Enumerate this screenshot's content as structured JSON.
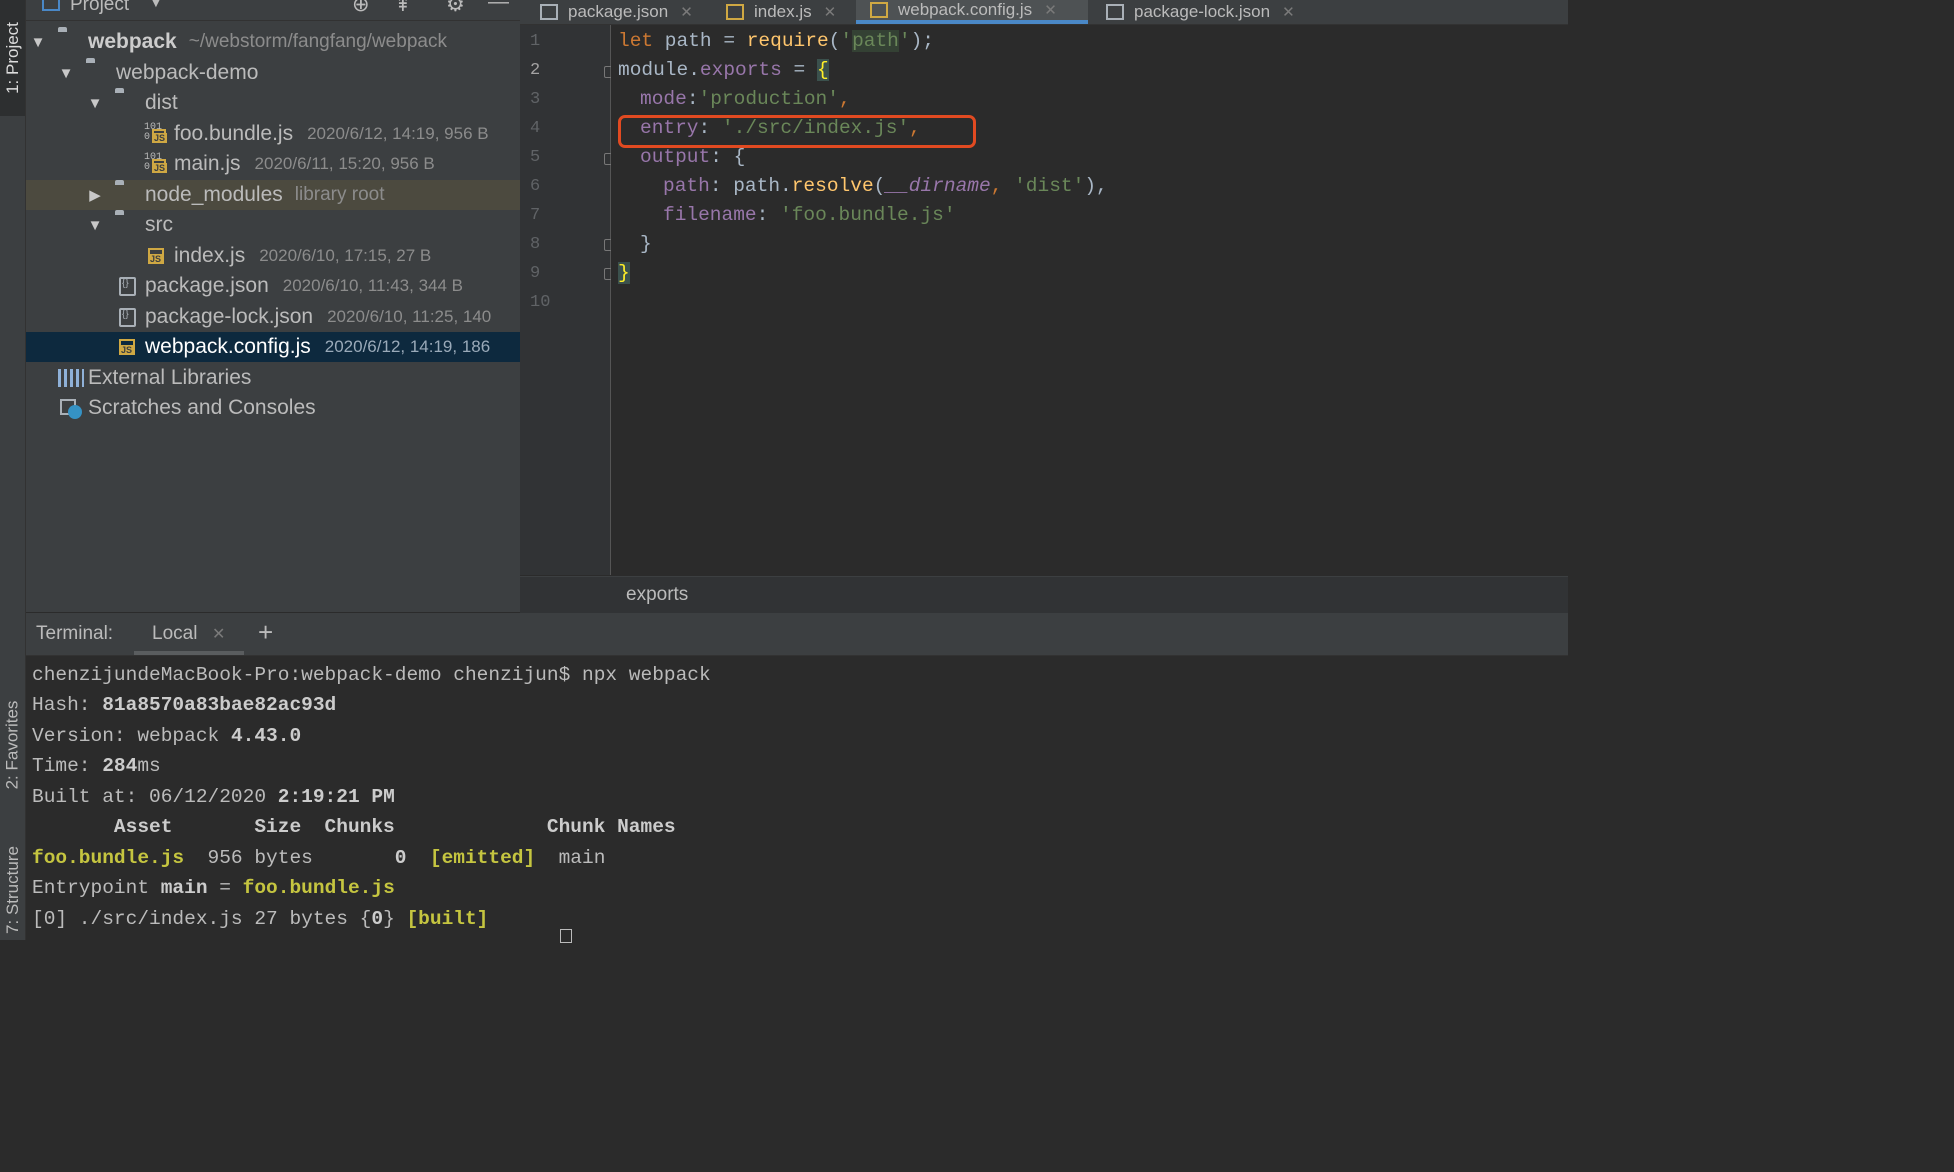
{
  "tool_windows": {
    "project": "1: Project",
    "favorites": "2: Favorites",
    "structure": "7: Structure"
  },
  "project_panel": {
    "title": "Project",
    "tree": [
      {
        "name": "webpack",
        "meta": "~/webstorm/fangfang/webpack"
      },
      {
        "name": "webpack-demo",
        "meta": ""
      },
      {
        "name": "dist",
        "meta": ""
      },
      {
        "name": "foo.bundle.js",
        "meta": "2020/6/12, 14:19, 956 B"
      },
      {
        "name": "main.js",
        "meta": "2020/6/11, 15:20, 956 B"
      },
      {
        "name": "node_modules",
        "meta": "library root"
      },
      {
        "name": "src",
        "meta": ""
      },
      {
        "name": "index.js",
        "meta": "2020/6/10, 17:15, 27 B"
      },
      {
        "name": "package.json",
        "meta": "2020/6/10, 11:43, 344 B"
      },
      {
        "name": "package-lock.json",
        "meta": "2020/6/10, 11:25, 140"
      },
      {
        "name": "webpack.config.js",
        "meta": "2020/6/12, 14:19, 186"
      },
      {
        "name": "External Libraries",
        "meta": ""
      },
      {
        "name": "Scratches and Consoles",
        "meta": ""
      }
    ]
  },
  "editor": {
    "tabs": [
      {
        "label": "package.json"
      },
      {
        "label": "index.js"
      },
      {
        "label": "webpack.config.js",
        "active": true
      },
      {
        "label": "package-lock.json"
      }
    ],
    "line_numbers": [
      "1",
      "2",
      "3",
      "4",
      "5",
      "6",
      "7",
      "8",
      "9",
      "10"
    ],
    "code": {
      "l1": {
        "kw": "let",
        "a": " path = ",
        "fn": "require",
        "b": "(",
        "s1": "'",
        "s2": "path",
        "s3": "'",
        "c": ");"
      },
      "l2": {
        "a": "module.",
        "prop": "exports",
        "b": " = ",
        "brace": "{"
      },
      "l3": {
        "prop": "mode",
        "a": ":",
        "str": "'production'",
        "pu": ","
      },
      "l4": {
        "prop": "entry",
        "a": ": ",
        "str": "'./src/index.js'",
        "pu": ","
      },
      "l5": {
        "prop": "output",
        "a": ": {"
      },
      "l6": {
        "prop": "path",
        "a": ": path.",
        "fn": "resolve",
        "b": "(",
        "dir": "__dirname",
        "pu": ", ",
        "str": "'dist'",
        "c": "),"
      },
      "l7": {
        "prop": "filename",
        "a": ": ",
        "str": "'foo.bundle.js'"
      },
      "l8": {
        "a": "}"
      },
      "l9": {
        "brace": "}"
      }
    },
    "breadcrumb": "exports"
  },
  "terminal": {
    "label": "Terminal:",
    "tab": "Local",
    "add": "+",
    "lines": {
      "prompt": "chenzijundeMacBook-Pro:webpack-demo chenzijun$ npx webpack",
      "hash_label": "Hash: ",
      "hash": "81a8570a83bae82ac93d",
      "version_label": "Version: webpack ",
      "version": "4.43.0",
      "time_label": "Time: ",
      "time": "284",
      "time_unit": "ms",
      "built_label": "Built at: 06/12/2020 ",
      "built_time": "2:19:21 PM",
      "table_header": "       Asset       Size  Chunks             Chunk Names",
      "asset": "foo.bundle.js",
      "size": "  956 bytes       ",
      "chunk": "0",
      "emitted": "  [emitted]",
      "chunk_name": "  main",
      "entry_label": "Entrypoint ",
      "entry_main": "main",
      "entry_eq": " = ",
      "entry_file": "foo.bundle.js",
      "built_line_a": "[0] ./src/index.js 27 bytes {",
      "built_zero": "0",
      "built_line_b": "} ",
      "built_tag": "[built]"
    }
  }
}
